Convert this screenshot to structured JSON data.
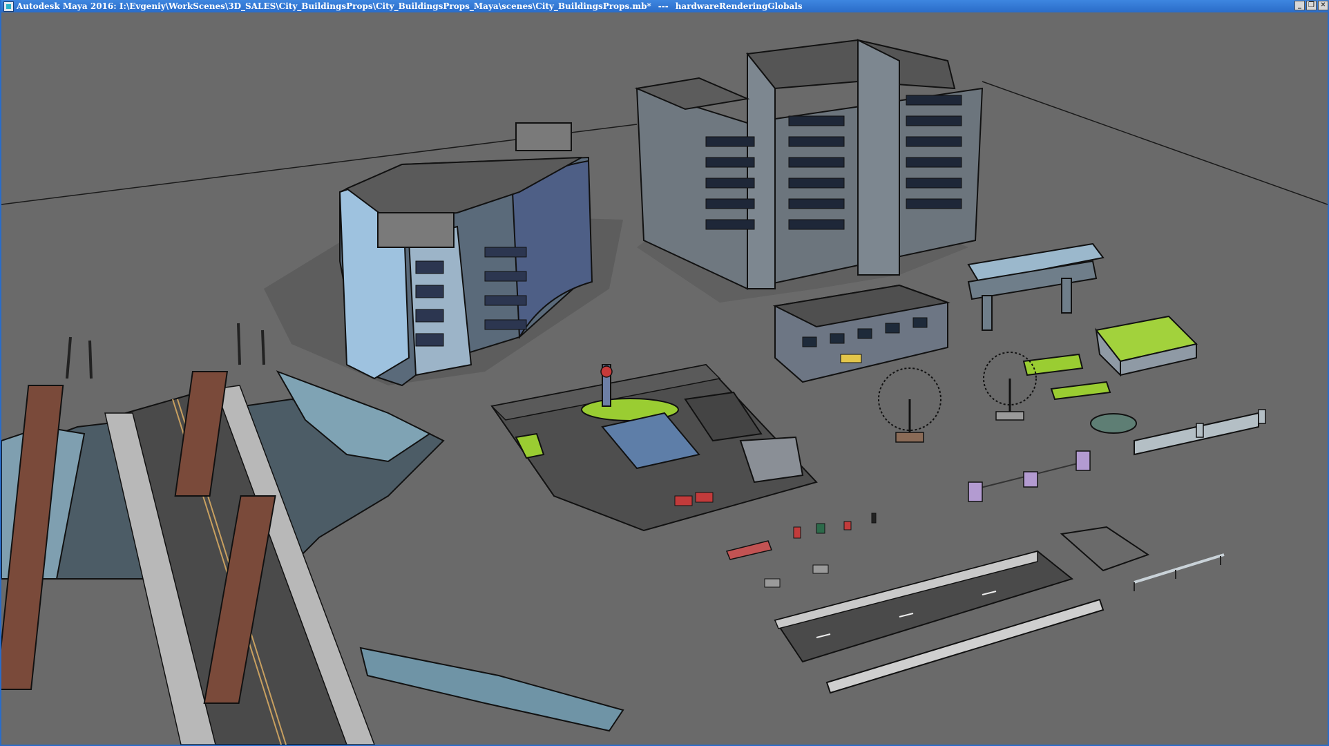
{
  "window": {
    "title": "Autodesk Maya 2016: I:\\Evgeniy\\WorkScenes\\3D_SALES\\City_BuildingsProps\\City_BuildingsProps_Maya\\scenes\\City_BuildingsProps.mb*",
    "separator": "---",
    "panel_name": "hardwareRenderingGlobals",
    "controls": {
      "minimize": "_",
      "restore": "❐",
      "close": "✕"
    },
    "icon": "maya-app-icon"
  },
  "viewport": {
    "render_style": "toon-shaded",
    "background_color": "#6a6a6a",
    "objects": [
      "bridge",
      "curved-office-building",
      "tall-apartment-building",
      "gas-station",
      "two-story-shop",
      "elevated-walkway",
      "green-roof-kiosk",
      "tree",
      "tree",
      "planter",
      "fence",
      "bollards",
      "bench",
      "street-props",
      "road-segment",
      "sidewalk-strip",
      "pavement-tile",
      "guard-rail"
    ]
  }
}
